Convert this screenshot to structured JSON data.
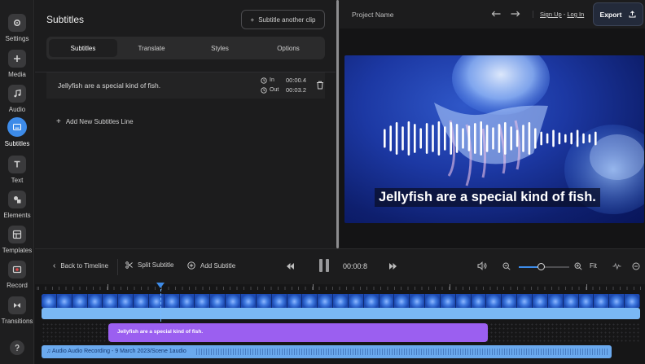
{
  "rail": [
    {
      "label": "Settings",
      "icon": "gear-icon"
    },
    {
      "label": "Media",
      "icon": "plus-icon"
    },
    {
      "label": "Audio",
      "icon": "music-icon"
    },
    {
      "label": "Subtitles",
      "icon": "subtitles-icon",
      "active": true
    },
    {
      "label": "Text",
      "icon": "text-icon"
    },
    {
      "label": "Elements",
      "icon": "elements-icon"
    },
    {
      "label": "Templates",
      "icon": "templates-icon"
    },
    {
      "label": "Record",
      "icon": "record-icon"
    },
    {
      "label": "Transitions",
      "icon": "transitions-icon"
    }
  ],
  "help_icon": "help-icon",
  "panel": {
    "title": "Subtitles",
    "subtitle_clip_button": "Subtitle another clip",
    "tabs": [
      "Subtitles",
      "Translate",
      "Styles",
      "Options"
    ],
    "active_tab": "Subtitles",
    "lines": [
      {
        "text": "Jellyfish are a special kind of fish.",
        "in_label": "In",
        "in_time": "00:00.4",
        "out_label": "Out",
        "out_time": "00:03.2"
      }
    ],
    "add_line_label": "Add New Subtitles Line"
  },
  "topbar": {
    "project_name": "Project Name",
    "sign_up": "Sign Up",
    "separator": "-",
    "log_in": "Log In",
    "export_label": "Export"
  },
  "preview": {
    "caption": "Jellyfish are a special kind of fish.",
    "waveform_bars": [
      0.55,
      0.75,
      0.95,
      0.7,
      1.0,
      0.85,
      0.6,
      0.9,
      0.8,
      1.0,
      0.7,
      0.95,
      0.85,
      0.6,
      0.75,
      0.9,
      1.0,
      0.8,
      0.65,
      0.85,
      0.95,
      0.7,
      0.5,
      0.8,
      0.95,
      0.6,
      0.4,
      0.3,
      0.5,
      0.35,
      0.25,
      0.35,
      0.5,
      0.3,
      0.25,
      0.4
    ]
  },
  "controls": {
    "back_to_timeline": "Back to Timeline",
    "split_subtitle": "Split Subtitle",
    "add_subtitle": "Add Subtitle",
    "time": "00:00:8",
    "zoom_level": 0.45,
    "fit_label": "Fit"
  },
  "timeline": {
    "subtitle_clip_text": "Jellyfish are a special kind of fish.",
    "audio_clip_text": "Audio Audio Recording - 9 March 2023/Scene 1audio",
    "accent": "#3d8be8",
    "subtitle_color": "#9b5ff0",
    "video_color": "#7ab8f5"
  }
}
